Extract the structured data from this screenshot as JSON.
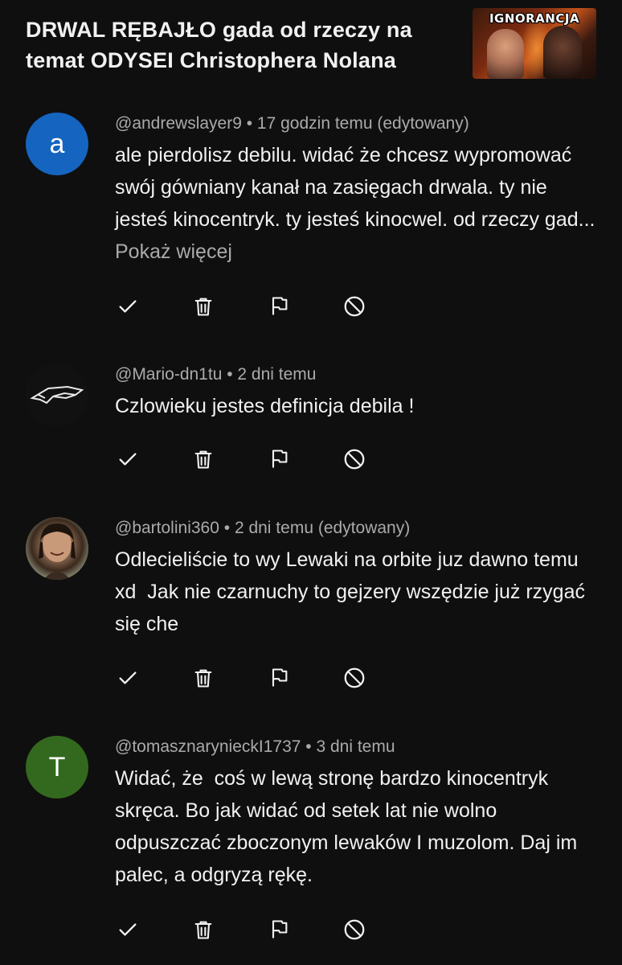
{
  "video": {
    "title": "DRWAL RĘBAJŁO gada od rzeczy na temat ODYSEI Christophera Nolana",
    "thumbnail_text": "IGNORANCJA"
  },
  "comments": [
    {
      "author": "@andrewslayer9",
      "time": "17 godzin temu (edytowany)",
      "avatar_letter": "a",
      "avatar_color": "#1565c0",
      "text": "ale pierdolisz debilu. widać że chcesz wypromować swój gówniany kanał na zasięgach drwala. ty nie jesteś kinocentryk. ty jesteś kinocwel. od rzeczy gad...",
      "more_label": "Pokaż więcej"
    },
    {
      "author": "@Mario-dn1tu",
      "time": "2 dni temu",
      "avatar_letter": "",
      "avatar_color": "#111111",
      "text": "Czlowieku jestes definicja debila !"
    },
    {
      "author": "@bartolini360",
      "time": "2 dni temu (edytowany)",
      "avatar_letter": "",
      "avatar_color": "#8a8f7a",
      "text": "Odlecieliście to wy Lewaki na orbite juz dawno temu xd  Jak nie czarnuchy to gejzery wszędzie już rzygać się che"
    },
    {
      "author": "@tomasznarynieckI1737",
      "time": "3 dni temu",
      "avatar_letter": "T",
      "avatar_color": "#33691e",
      "text": "Widać, że  coś w lewą stronę bardzo kinocentryk skręca. Bo jak widać od setek lat nie wolno odpuszczać zboczonym lewaków I muzolom. Daj im palec, a odgryzą rękę."
    }
  ],
  "separator": " • ",
  "action_icons": [
    "approve-icon",
    "delete-icon",
    "report-icon",
    "block-icon"
  ],
  "colors": {
    "background": "#0f0f0f",
    "text": "#f1f1f1",
    "secondary_text": "#aaaaaa"
  }
}
